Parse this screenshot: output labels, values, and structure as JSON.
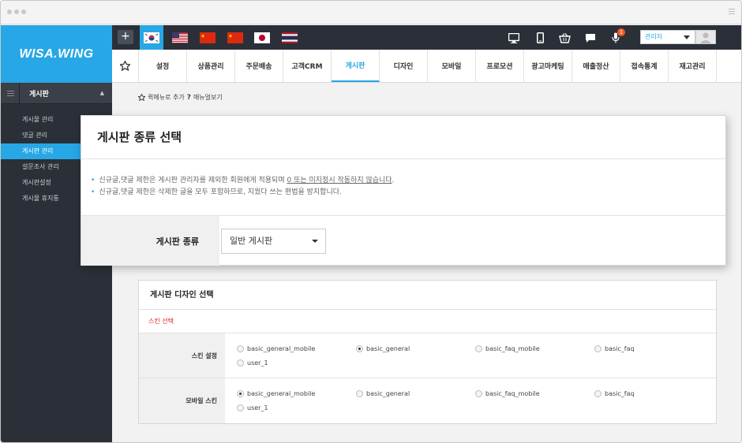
{
  "app": {
    "logo": "WISA.WING"
  },
  "sidebar": {
    "section_title": "게시판",
    "items": [
      {
        "label": "게시물 관리",
        "active": false
      },
      {
        "label": "댓글 관리",
        "active": false
      },
      {
        "label": "게시판 관리",
        "active": true
      },
      {
        "label": "설문조사 관리",
        "active": false
      },
      {
        "label": "게시판설정",
        "active": false
      },
      {
        "label": "게시물 휴지통",
        "active": false
      }
    ]
  },
  "topbar": {
    "plus_label": "+",
    "languages": [
      "korea-flag",
      "usa-flag",
      "china-flag",
      "china-flag",
      "japan-flag",
      "thailand-flag"
    ],
    "notification_count": "1",
    "admin_label": "관리자"
  },
  "nav": {
    "items": [
      "설정",
      "상품관리",
      "주문배송",
      "고객CRM",
      "게시판",
      "디자인",
      "모바일",
      "프로모션",
      "광고마케팅",
      "매출정산",
      "접속통계",
      "재고관리"
    ],
    "active": "게시판"
  },
  "quick": {
    "add": "퀵메뉴로 추가",
    "view": "매뉴얼보기"
  },
  "modal": {
    "title": "게시판 종류 선택",
    "note1_pre": "신규글,댓글 제한은 게시판 관리자를 제외한 회원에게 적용되며 ",
    "note1_underline": "0 또는 미지정시 작동하지 않습니다",
    "note1_post": ".",
    "note2": "신규글,댓글 제한은 삭제한 글을 모두 포함하므로, 지웠다 쓰는 편법을 방지합니다.",
    "type_label": "게시판 종류",
    "type_value": "일반 게시판"
  },
  "design": {
    "title": "게시판 디자인 선택",
    "skin_select": "스킨 선택",
    "rows": [
      {
        "label": "스킨 설정",
        "options": [
          "basic_general_mobile",
          "basic_general",
          "basic_faq_mobile",
          "basic_faq",
          "user_1"
        ],
        "selected": "basic_general"
      },
      {
        "label": "모바일 스킨",
        "options": [
          "basic_general_mobile",
          "basic_general",
          "basic_faq_mobile",
          "basic_faq",
          "user_1"
        ],
        "selected": "basic_general_mobile"
      }
    ]
  },
  "colors": {
    "accent": "#27a7e5",
    "dark": "#2b3038",
    "alert": "#e02020"
  }
}
